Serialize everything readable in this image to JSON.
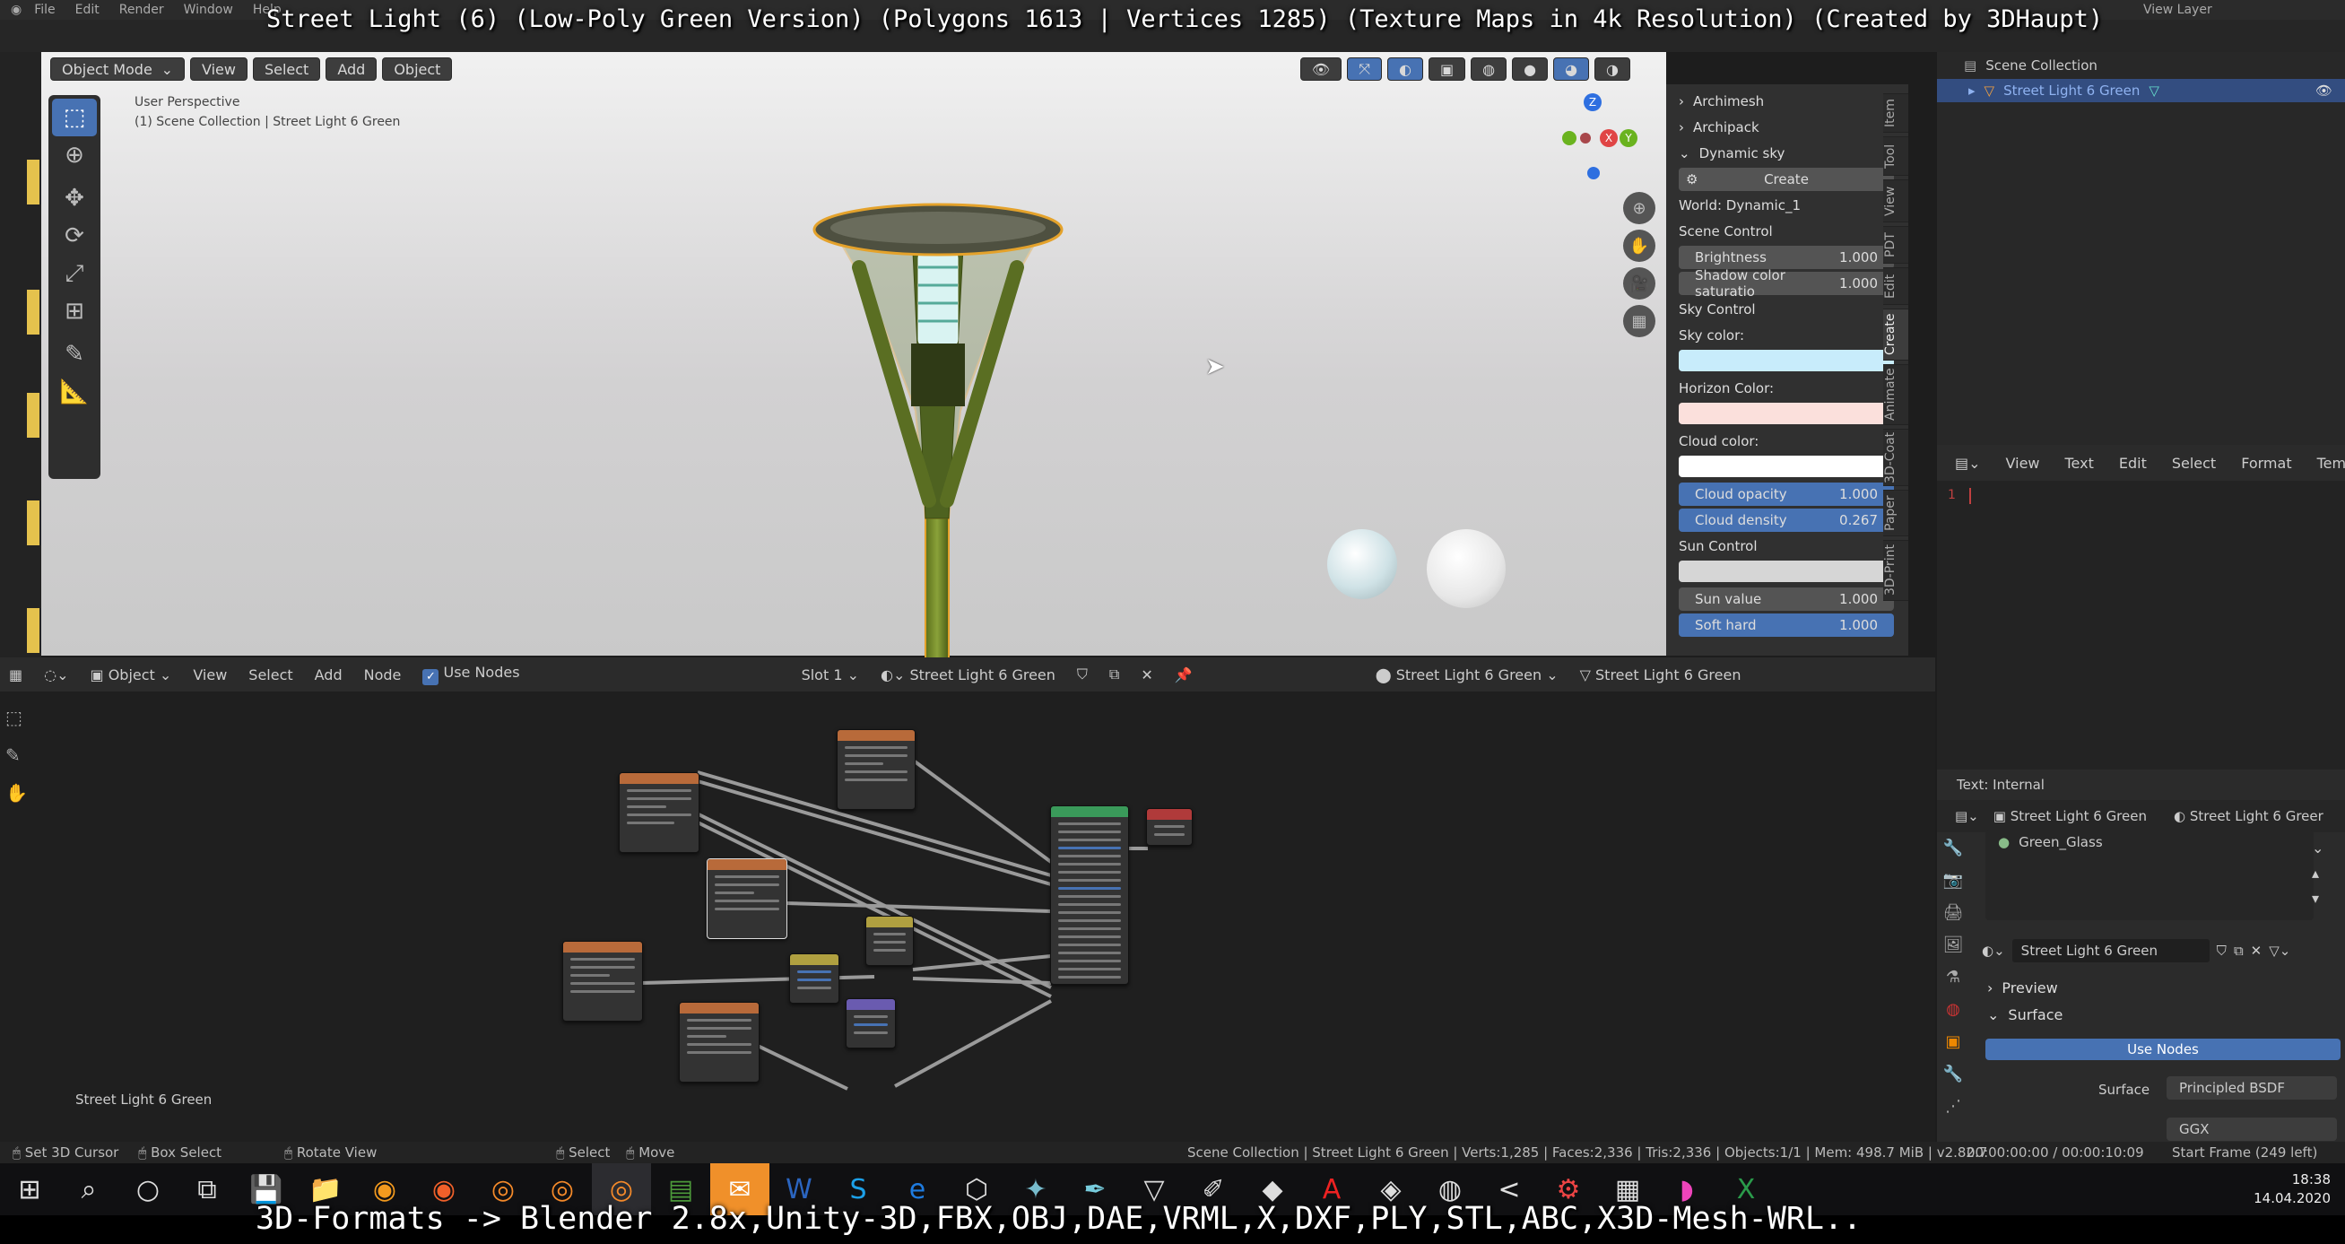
{
  "video_title": "Street Light (6) (Low-Poly Green Version) (Polygons 1613 | Vertices 1285) (Texture Maps in 4k Resolution) (Created by 3DHaupt)",
  "video_footer": "3D-Formats -> Blender 2.8x,Unity-3D,FBX,OBJ,DAE,VRML,X,DXF,PLY,STL,ABC,X3D-Mesh-WRL..",
  "topbar": {
    "menus": [
      "File",
      "Edit",
      "Render",
      "Window",
      "Help"
    ],
    "right_label": "View Layer"
  },
  "viewport": {
    "header": {
      "mode": "Object Mode",
      "menus": [
        "View",
        "Select",
        "Add",
        "Object"
      ]
    },
    "overlay_line1": "User Perspective",
    "overlay_line2": "(1) Scene Collection | Street Light 6 Green",
    "gizmo": {
      "x": "X",
      "y": "Y",
      "z": "Z"
    }
  },
  "npanel": {
    "sections": [
      "Archimesh",
      "Archipack",
      "Dynamic sky"
    ],
    "create_label": "Create",
    "world_label": "World: Dynamic_1",
    "scene_control": "Scene Control",
    "brightness": {
      "label": "Brightness",
      "value": "1.000"
    },
    "shadow": {
      "label": "Shadow color saturatio",
      "value": "1.000"
    },
    "sky_control": "Sky Control",
    "sky_color": "Sky color:",
    "horizon_color": "Horizon Color:",
    "cloud_color": "Cloud color:",
    "cloud_opacity": {
      "label": "Cloud opacity",
      "value": "1.000"
    },
    "cloud_density": {
      "label": "Cloud density",
      "value": "0.267"
    },
    "sun_control": "Sun Control",
    "sun_value": {
      "label": "Sun value",
      "value": "1.000"
    },
    "soft_hard": {
      "label": "Soft hard",
      "value": "1.000"
    },
    "tabs": [
      "Item",
      "Tool",
      "View",
      "PDT",
      "Edit",
      "Create",
      "Animate",
      "3D-Coat",
      "Paper",
      "3D-Print"
    ],
    "colors": {
      "sky": "#c8ecfb",
      "horizon": "#fbe0dc",
      "cloud": "#ffffff",
      "sun": "#d6d6d6"
    }
  },
  "outliner": {
    "root": "Scene Collection",
    "item": "Street Light 6 Green"
  },
  "text_editor": {
    "menus": [
      "View",
      "Text",
      "Edit",
      "Select",
      "Format",
      "Templates"
    ],
    "line_number": "1",
    "status": "Text: Internal"
  },
  "node_editor": {
    "object_menu": "Object",
    "menus": [
      "View",
      "Select",
      "Add",
      "Node"
    ],
    "use_nodes": "Use Nodes",
    "slot": "Slot 1",
    "material": "Street Light 6 Green",
    "right_object": "Street Light 6 Green",
    "right_mesh": "Street Light 6 Green",
    "footer_label": "Street Light 6 Green"
  },
  "properties": {
    "header_object": "Street Light 6 Green",
    "header_material": "Street Light 6 Greer",
    "slot_item": "Green_Glass",
    "material_field": "Street Light 6 Green",
    "preview": "Preview",
    "surface_section": "Surface",
    "use_nodes_btn": "Use Nodes",
    "surface_label": "Surface",
    "surface_value": "Principled BSDF",
    "distribution": "GGX"
  },
  "statusbar": {
    "left": [
      "Set 3D Cursor",
      "Box Select",
      "Rotate View"
    ],
    "mid": [
      "Select",
      "Move"
    ],
    "info": "Scene Collection | Street Light 6 Green | Verts:1,285 | Faces:2,336 | Tris:2,336 | Objects:1/1 | Mem: 498.7 MiB | v2.82.7",
    "timecode": "00:00:00:00 / 00:00:10:09",
    "frame": "Start Frame (249 left)"
  },
  "taskbar": {
    "time": "18:38",
    "date": "14.04.2020"
  }
}
